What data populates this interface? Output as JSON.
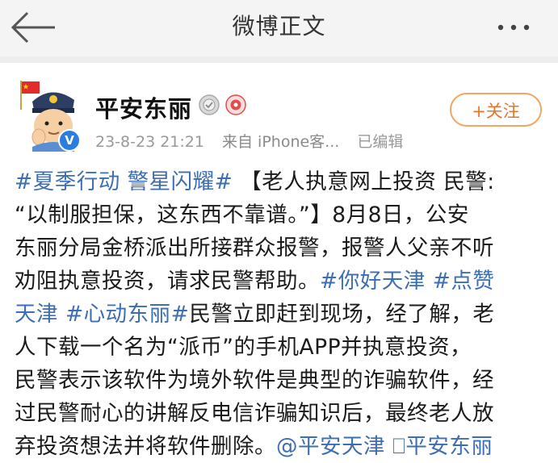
{
  "header": {
    "title": "微博正文",
    "back_icon": "back-arrow-icon",
    "more_icon": "more-dots-icon"
  },
  "author": {
    "name": "平安东丽",
    "verified_badge": "V",
    "time": "23-8-23 21:21",
    "source": "来自 iPhone客...",
    "edited": "已编辑",
    "follow_label": "+关注"
  },
  "post": {
    "l1": [
      "#夏季行动 警星闪耀#",
      "【老人执意网上投资 民警:"
    ],
    "l2": "“以制服担保，这东西不靠谱。”】8月8日，公安",
    "l3": "东丽分局金桥派出所接群众报警，报警人父亲不听",
    "l4": [
      "劝阻执意投资，请求民警帮助。",
      "#你好天津",
      " ",
      "#点赞"
    ],
    "l5": [
      "天津",
      " ",
      "#心动东丽#",
      "民警立即赶到现场，经了解，老"
    ],
    "l6": "人下载一个名为“派币”的手机APP并执意投资，",
    "l7": "民警表示该软件为境外软件是典型的诈骗软件，经",
    "l8": "过民警耐心的讲解反电信诈骗知识后，最终老人放",
    "l9": [
      "弃投资想法并将软件删除。",
      "@平安天津",
      " ",
      "⎕平安东丽"
    ]
  },
  "colors": {
    "link": "#3c6eb4",
    "follow": "#e8742a",
    "meta": "#999999",
    "topbar": "#f4f4f4"
  }
}
